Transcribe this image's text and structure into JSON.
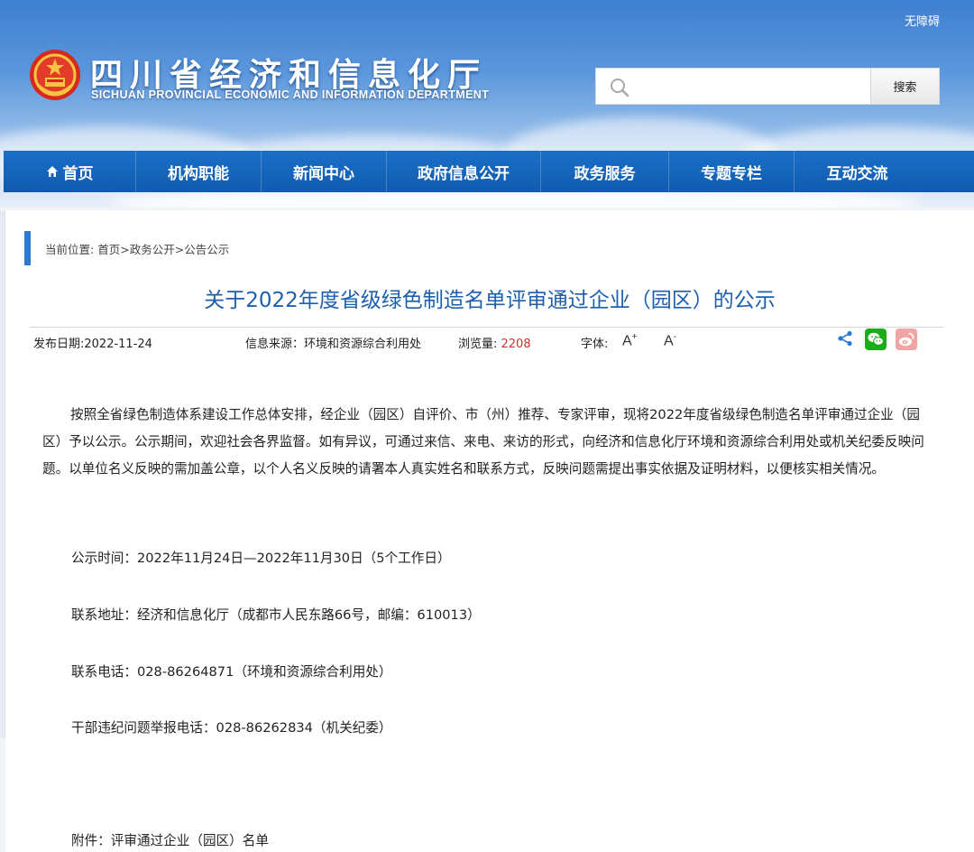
{
  "header": {
    "accessibility": "无障碍",
    "title_cn": "四川省经济和信息化厅",
    "title_en": "SICHUAN PROVINCIAL ECONOMIC AND INFORMATION DEPARTMENT",
    "search_placeholder": "",
    "search_button": "搜索"
  },
  "nav": {
    "items": [
      {
        "label": "首页"
      },
      {
        "label": "机构职能"
      },
      {
        "label": "新闻中心"
      },
      {
        "label": "政府信息公开"
      },
      {
        "label": "政务服务"
      },
      {
        "label": "专题专栏"
      },
      {
        "label": "互动交流"
      }
    ]
  },
  "breadcrumb": {
    "prefix": "当前位置: ",
    "home": "首页",
    "sep1": ">",
    "section": "政务公开",
    "sep2": ">",
    "current": "公告公示"
  },
  "article": {
    "title": "关于2022年度省级绿色制造名单评审通过企业（园区）的公示",
    "publish_date": "发布日期:2022-11-24",
    "source": "信息来源：环境和资源综合利用处",
    "views_label": "浏览量: ",
    "views": "2208",
    "font_label": "字体:",
    "font_up": "A",
    "font_up_sign": "+",
    "font_down": "A",
    "font_down_sign": "-",
    "paragraph1": "按照全省绿色制造体系建设工作总体安排，经企业（园区）自评价、市（州）推荐、专家评审，现将2022年度省级绿色制造名单评审通过企业（园区）予以公示。公示期间，欢迎社会各界监督。如有异议，可通过来信、来电、来访的形式，向经济和信息化厅环境和资源综合利用处或机关纪委反映问题。以单位名义反映的需加盖公章，以个人名义反映的请署本人真实姓名和联系方式，反映问题需提出事实依据及证明材料，以便核实相关情况。",
    "period": "公示时间：2022年11月24日—2022年11月30日（5个工作日）",
    "address": "联系地址：经济和信息化厅（成都市人民东路66号，邮编：610013）",
    "phone": "联系电话：028-86264871（环境和资源综合利用处）",
    "report_phone": "干部违纪问题举报电话：028-86262834（机关纪委）",
    "attachment": "附件：评审通过企业（园区）名单"
  },
  "colors": {
    "nav_blue": "#1367bf",
    "title_blue": "#1d5fad",
    "views_red": "#d92c2c",
    "wechat_green": "#1aad19",
    "weibo_pink": "#f0a4a4"
  }
}
